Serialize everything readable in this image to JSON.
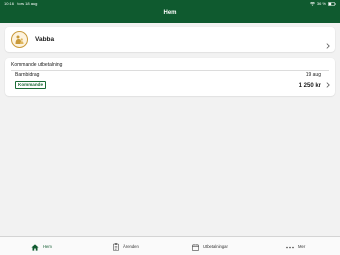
{
  "status_bar": {
    "time": "10:16",
    "date": "tors 18 aug",
    "battery": "36 %"
  },
  "header": {
    "title": "Hem"
  },
  "vabba_card": {
    "label": "Vabba"
  },
  "payment_card": {
    "title": "Kommande utbetalning",
    "type": "Barnbidrag",
    "date": "19 aug",
    "status": "Kommande",
    "amount": "1 250 kr"
  },
  "tab_bar": {
    "tabs": [
      {
        "label": "Hem",
        "icon": "house-icon",
        "active": true
      },
      {
        "label": "Ärenden",
        "icon": "clipboard-icon",
        "active": false
      },
      {
        "label": "Utbetalningar",
        "icon": "calendar-icon",
        "active": false
      },
      {
        "label": "Mer",
        "icon": "more-dots-icon",
        "active": false
      }
    ]
  },
  "colors": {
    "header_green": "#0f5a2f",
    "status_green": "#1b6b36",
    "background": "#f2f2f2",
    "badge_gold": "#c99a3b"
  }
}
